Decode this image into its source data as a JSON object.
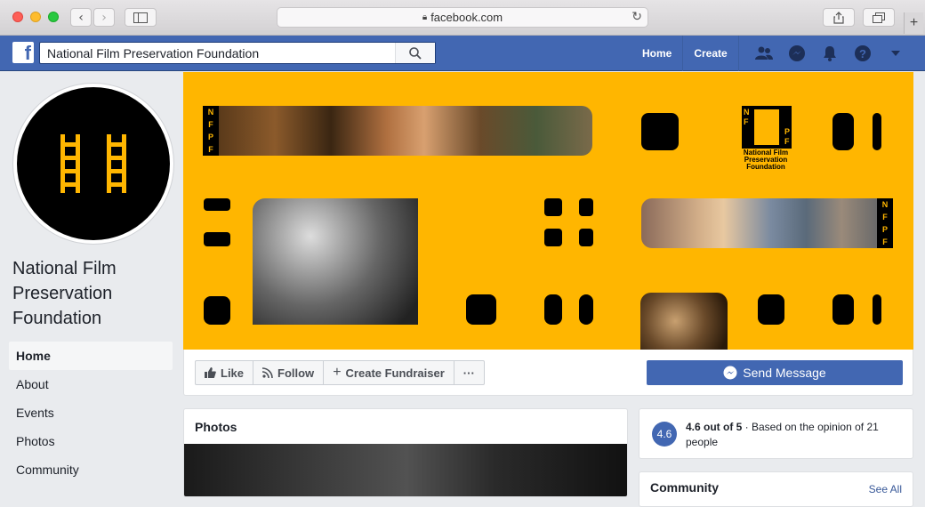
{
  "browser": {
    "url": "facebook.com",
    "lock_icon": "lock-icon"
  },
  "fb": {
    "logo": "f",
    "search_value": "National Film Preservation Foundation",
    "nav_links": [
      "Home",
      "Create"
    ]
  },
  "page": {
    "name": "National Film Preservation Foundation",
    "nav": [
      "Home",
      "About",
      "Events",
      "Photos",
      "Community"
    ],
    "active_nav": "Home"
  },
  "cover": {
    "logo_letters_left": [
      "N",
      "F"
    ],
    "logo_letters_right": [
      "P",
      "F"
    ],
    "logo_caption": "National Film Preservation Foundation",
    "strip_left_letters": [
      "N",
      "F",
      "P",
      "F"
    ],
    "strip_right_letters": [
      "N",
      "F",
      "P",
      "F"
    ]
  },
  "actions": {
    "like": "Like",
    "follow": "Follow",
    "fundraiser": "Create Fundraiser",
    "more": "···",
    "send_message": "Send Message"
  },
  "photos": {
    "title": "Photos"
  },
  "rating": {
    "score": "4.6",
    "summary": "4.6 out of 5",
    "detail": " · Based on the opinion of 21 people"
  },
  "community": {
    "title": "Community",
    "see_all": "See All"
  },
  "colors": {
    "fb_blue": "#4267b2",
    "cover_yellow": "#ffb600"
  }
}
